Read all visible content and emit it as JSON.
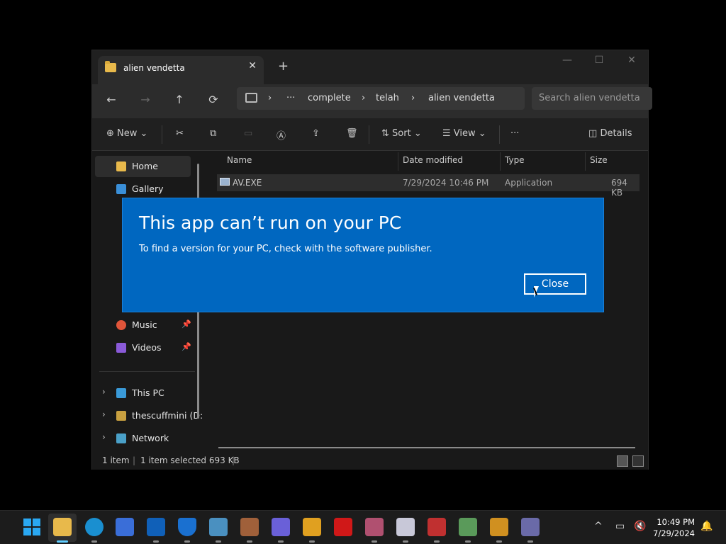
{
  "explorer": {
    "tab_title": "alien vendetta",
    "tab_close": "✕",
    "new_tab": "+",
    "window_controls": {
      "minimize": "—",
      "maximize": "☐",
      "close": "✕"
    },
    "nav": {
      "back": "←",
      "forward": "→",
      "up": "↑",
      "refresh": "⟳"
    },
    "breadcrumb": {
      "sep": "›",
      "more": "···",
      "items": [
        "complete",
        "telah",
        "alien vendetta"
      ]
    },
    "search_placeholder": "Search alien vendetta",
    "toolbar": {
      "new_label": "New",
      "sort_label": "Sort",
      "view_label": "View",
      "more_label": "···",
      "details_label": "Details",
      "chevron": "⌄",
      "icons": {
        "cut": "✂",
        "copy": "⧉",
        "paste": "▭",
        "rename": "Ⓐ",
        "share": "⇪",
        "delete": "🗑",
        "new": "⊕"
      }
    },
    "sidebar": {
      "items": [
        {
          "label": "Home",
          "color": "#e8b94b"
        },
        {
          "label": "Gallery",
          "color": "#3a8fd8"
        },
        {
          "label": "Music",
          "color": "#e0553a"
        },
        {
          "label": "Videos",
          "color": "#8a5ad8"
        },
        {
          "label": "This PC",
          "color": "#3a9ad8"
        },
        {
          "label": "thescuffmini (D:",
          "color": "#c8a040"
        },
        {
          "label": "Network",
          "color": "#4aa0c8"
        }
      ],
      "pin": "📌",
      "expand": "›"
    },
    "columns": {
      "name": "Name",
      "date": "Date modified",
      "type": "Type",
      "size": "Size"
    },
    "rows": [
      {
        "name": "AV.EXE",
        "date": "7/29/2024 10:46 PM",
        "type": "Application",
        "size": "694 KB"
      }
    ],
    "status": {
      "count": "1 item",
      "selected": "1 item selected  693 KB",
      "divider": "|"
    }
  },
  "dialog": {
    "title": "This app can’t run on your PC",
    "message": "To find a version for your PC, check with the software publisher.",
    "close_label": "Close"
  },
  "taskbar": {
    "time": "10:49 PM",
    "date": "7/29/2024",
    "tray_chevron": "^"
  },
  "colors": {
    "dialog_blue": "#0067c0",
    "accent": "#60cdff"
  }
}
